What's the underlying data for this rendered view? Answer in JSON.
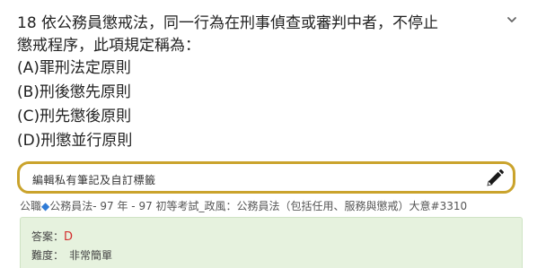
{
  "question": {
    "line1": "18 依公務員懲戒法，同一行為在刑事偵查或審判中者，不停止",
    "line2": "懲戒程序，此項規定稱為：",
    "options": [
      "(A)罪刑法定原則",
      "(B)刑後懲先原則",
      "(C)刑先懲後原則",
      "(D)刑懲並行原則"
    ]
  },
  "icons": {
    "collapse": "chevron-down-icon",
    "edit": "pencil-icon"
  },
  "note": {
    "placeholder": "編輯私有筆記及自訂標籤"
  },
  "tags": {
    "prefix": "公職",
    "diamond": "◆",
    "text": "公務員法- 97 年 - 97 初等考試_政風：公務員法（包括任用、服務與懲戒）大意#3310"
  },
  "answer": {
    "label": "答案：",
    "value": "D",
    "difficulty_label": "難度：",
    "difficulty_value": "非常簡單"
  },
  "colors": {
    "note_border": "#caa32c",
    "answer_bg": "#e6f2de",
    "answer_value": "#d32f2f",
    "tag_diamond": "#2f7bd6"
  }
}
